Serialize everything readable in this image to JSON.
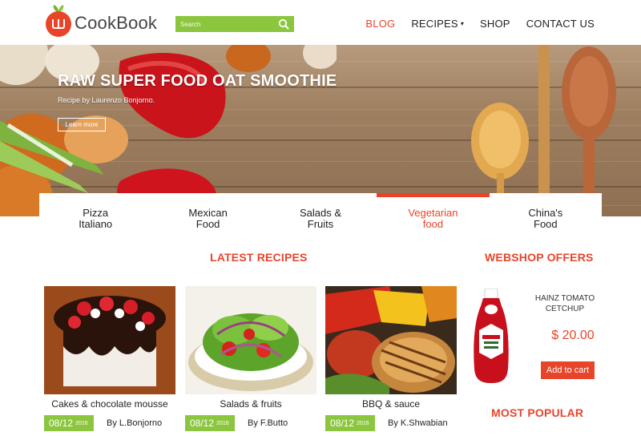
{
  "brand": {
    "name": "CookBook"
  },
  "search": {
    "placeholder": "Search"
  },
  "nav": [
    {
      "label": "BLOG",
      "active": true
    },
    {
      "label": "RECIPES",
      "dropdown": true
    },
    {
      "label": "SHOP"
    },
    {
      "label": "CONTACT US"
    }
  ],
  "hero": {
    "title": "RAW SUPER FOOD OAT SMOOTHIE",
    "subtitle": "Recipe by Laurenzo Bonjorno.",
    "button": "Learn more"
  },
  "categories": [
    {
      "line1": "Pizza",
      "line2": "Italiano"
    },
    {
      "line1": "Mexican",
      "line2": "Food"
    },
    {
      "line1": "Salads &",
      "line2": "Fruits"
    },
    {
      "line1": "Vegetarian",
      "line2": "food",
      "active": true
    },
    {
      "line1": "China's",
      "line2": "Food"
    }
  ],
  "latest": {
    "title": "LATEST RECIPES",
    "cards": [
      {
        "title": "Cakes & chocolate mousse",
        "date": "08/12",
        "year": "2016",
        "author": "By L.Bonjorno",
        "image": "chocolate-cake-image"
      },
      {
        "title": "Salads & fruits",
        "date": "08/12",
        "year": "2016",
        "author": "By F.Butto",
        "image": "salad-image"
      },
      {
        "title": "BBQ & sauce",
        "date": "08/12",
        "year": "2016",
        "author": "By K.Shwabian",
        "image": "bbq-image"
      }
    ]
  },
  "webshop": {
    "title": "WEBSHOP OFFERS",
    "product": {
      "name": "HAINZ TOMATO CETCHUP",
      "price": "$ 20.00",
      "button": "Add to cart",
      "image": "ketchup-bottle-image"
    }
  },
  "popular": {
    "title": "MOST POPULAR"
  },
  "colors": {
    "accent": "#e8442a",
    "green": "#8cc63f"
  }
}
